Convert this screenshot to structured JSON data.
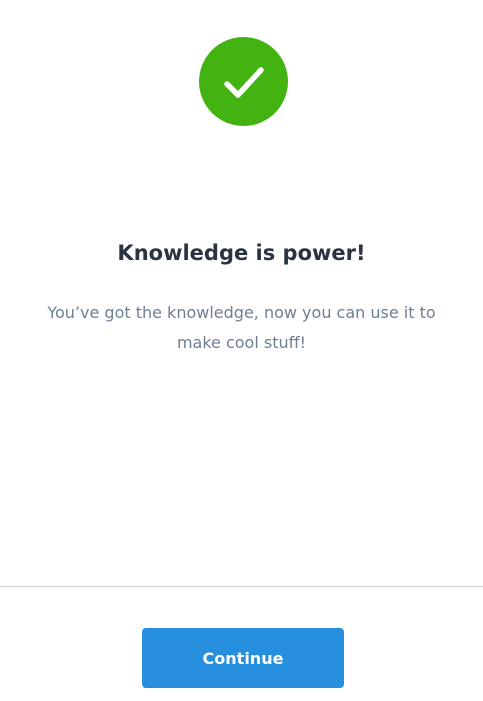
{
  "icon": {
    "name": "checkmark-icon",
    "background_color": "#43b311",
    "check_color": "#ffffff"
  },
  "title": "Knowledge is power!",
  "message": "You’ve got the knowledge, now you can use it to make cool stuff!",
  "divider_color": "#c8d1dc",
  "continue_button": {
    "label": "Continue",
    "background_color": "#2690de"
  }
}
